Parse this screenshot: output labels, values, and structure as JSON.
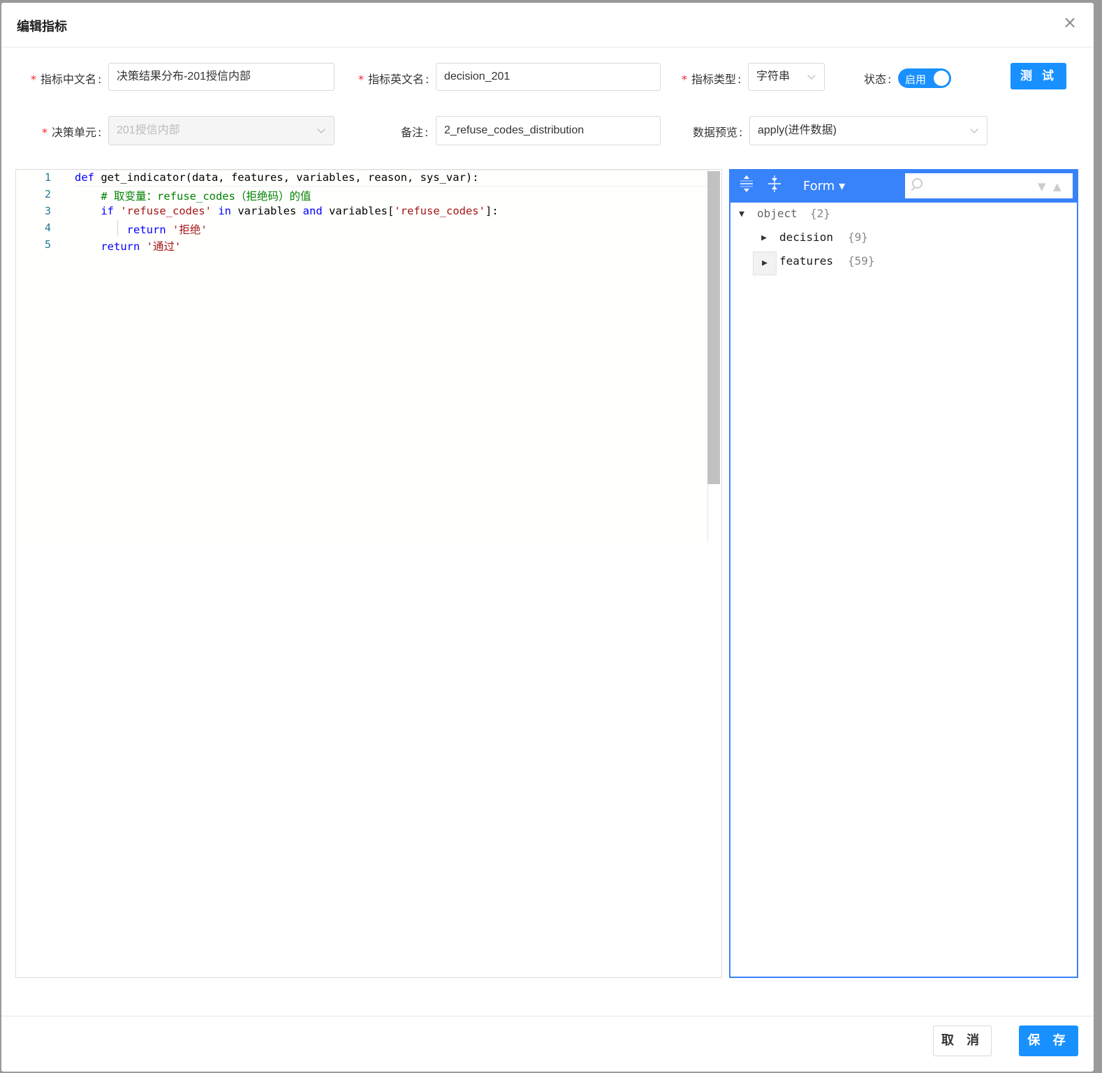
{
  "dialog": {
    "title": "编辑指标",
    "close_glyph": "×"
  },
  "form": {
    "cn_name_label": "指标中文名",
    "cn_name_value": "决策结果分布-201授信内部",
    "en_name_label": "指标英文名",
    "en_name_value": "decision_201",
    "type_label": "指标类型",
    "type_value": "字符串",
    "status_label": "状态",
    "status_toggle_label": "启用",
    "test_button": "测 试",
    "unit_label": "决策单元",
    "unit_value": "201授信内部",
    "remark_label": "备注",
    "remark_value": "2_refuse_codes_distribution",
    "preview_label": "数据预览",
    "preview_value": "apply(进件数据)",
    "required_mark": "*",
    "colon": ":"
  },
  "editor": {
    "line_numbers": [
      "1",
      "2",
      "3",
      "4",
      "5"
    ],
    "lines": [
      [
        {
          "t": "def",
          "c": "kw"
        },
        {
          "t": " get_indicator(data, features, variables, reason, sys_var):",
          "c": ""
        }
      ],
      [
        {
          "t": "    # 取变量：refuse_codes（拒绝码）的值",
          "c": "cmt"
        }
      ],
      [
        {
          "t": "    ",
          "c": ""
        },
        {
          "t": "if",
          "c": "kw"
        },
        {
          "t": " ",
          "c": ""
        },
        {
          "t": "'refuse_codes'",
          "c": "str"
        },
        {
          "t": " ",
          "c": ""
        },
        {
          "t": "in",
          "c": "kw"
        },
        {
          "t": " variables ",
          "c": ""
        },
        {
          "t": "and",
          "c": "kw"
        },
        {
          "t": " variables[",
          "c": ""
        },
        {
          "t": "'refuse_codes'",
          "c": "str"
        },
        {
          "t": "]:",
          "c": ""
        }
      ],
      [
        {
          "t": "        ",
          "c": ""
        },
        {
          "t": "return",
          "c": "kw"
        },
        {
          "t": " ",
          "c": ""
        },
        {
          "t": "'拒绝'",
          "c": "str"
        }
      ],
      [
        {
          "t": "    ",
          "c": ""
        },
        {
          "t": "return",
          "c": "kw"
        },
        {
          "t": " ",
          "c": ""
        },
        {
          "t": "'通过'",
          "c": "str"
        }
      ]
    ]
  },
  "json_viewer": {
    "expand_all_icon": "expand-all-icon",
    "collapse_all_icon": "collapse-all-icon",
    "mode_label": "Form ▾",
    "search_placeholder": "",
    "search_next": "▼",
    "search_prev": "▲",
    "root_toggle": "▼",
    "root_key": "object",
    "root_count": "{2}",
    "children": [
      {
        "toggle": "▶",
        "key": "decision",
        "count": "{9}"
      },
      {
        "toggle": "▶",
        "key": "features",
        "count": "{59}"
      }
    ]
  },
  "footer": {
    "cancel_button": "取 消",
    "save_button": "保 存"
  },
  "colors": {
    "primary": "#1890ff",
    "json_accent": "#3883fa",
    "required": "#f5222d"
  }
}
